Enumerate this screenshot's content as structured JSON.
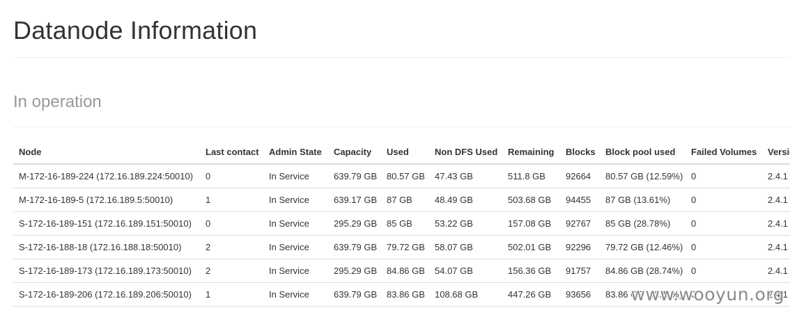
{
  "page": {
    "title": "Datanode Information",
    "section_title": "In operation"
  },
  "table": {
    "columns": [
      "Node",
      "Last contact",
      "Admin State",
      "Capacity",
      "Used",
      "Non DFS Used",
      "Remaining",
      "Blocks",
      "Block pool used",
      "Failed Volumes",
      "Version"
    ],
    "rows": [
      [
        "M-172-16-189-224 (172.16.189.224:50010)",
        "0",
        "In Service",
        "639.79 GB",
        "80.57 GB",
        "47.43 GB",
        "511.8 GB",
        "92664",
        "80.57 GB (12.59%)",
        "0",
        "2.4.1"
      ],
      [
        "M-172-16-189-5 (172.16.189.5:50010)",
        "1",
        "In Service",
        "639.17 GB",
        "87 GB",
        "48.49 GB",
        "503.68 GB",
        "94455",
        "87 GB (13.61%)",
        "0",
        "2.4.1"
      ],
      [
        "S-172-16-189-151 (172.16.189.151:50010)",
        "0",
        "In Service",
        "295.29 GB",
        "85 GB",
        "53.22 GB",
        "157.08 GB",
        "92767",
        "85 GB (28.78%)",
        "0",
        "2.4.1"
      ],
      [
        "S-172-16-188-18 (172.16.188.18:50010)",
        "2",
        "In Service",
        "639.79 GB",
        "79.72 GB",
        "58.07 GB",
        "502.01 GB",
        "92296",
        "79.72 GB (12.46%)",
        "0",
        "2.4.1"
      ],
      [
        "S-172-16-189-173 (172.16.189.173:50010)",
        "2",
        "In Service",
        "295.29 GB",
        "84.86 GB",
        "54.07 GB",
        "156.36 GB",
        "91757",
        "84.86 GB (28.74%)",
        "0",
        "2.4.1"
      ],
      [
        "S-172-16-189-206 (172.16.189.206:50010)",
        "1",
        "In Service",
        "639.79 GB",
        "83.86 GB",
        "108.68 GB",
        "447.26 GB",
        "93656",
        "83.86 GB (13.11%)",
        "0",
        "2.4.1"
      ]
    ]
  },
  "watermark": "www.wooyun.org"
}
